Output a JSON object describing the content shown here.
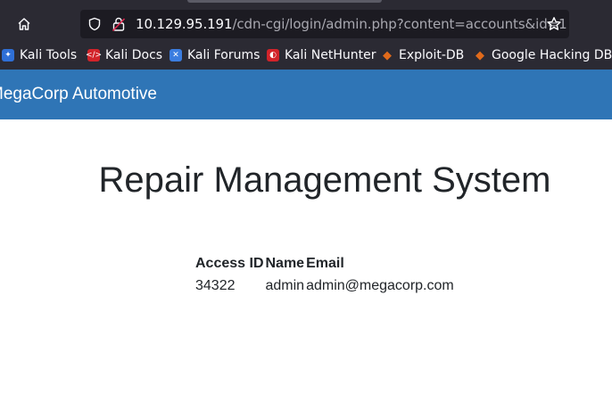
{
  "browser": {
    "url_host": "10.129.95.191",
    "url_path": "/cdn-cgi/login/admin.php?content=accounts&id=1",
    "bookmarks": [
      {
        "label": "Kali Tools",
        "icon": "kali-tools-icon",
        "color": "#2f6fd6"
      },
      {
        "label": "Kali Docs",
        "icon": "kali-docs-icon",
        "color": "#d2232a"
      },
      {
        "label": "Kali Forums",
        "icon": "kali-forums-icon",
        "color": "#3b7de0"
      },
      {
        "label": "Kali NetHunter",
        "icon": "kali-nethunter-icon",
        "color": "#d2232a"
      },
      {
        "label": "Exploit-DB",
        "icon": "exploit-db-icon",
        "color": "#e06a1b"
      },
      {
        "label": "Google Hacking DB",
        "icon": "ghdb-icon",
        "color": "#e06a1b"
      }
    ]
  },
  "navbar": {
    "brand": "MegaCorp Automotive",
    "color": "#2f75b6"
  },
  "page": {
    "title": "Repair Management System",
    "table": {
      "headers": [
        "Access ID",
        "Name",
        "Email"
      ],
      "rows": [
        [
          "34322",
          "admin",
          "admin@megacorp.com"
        ]
      ]
    }
  }
}
